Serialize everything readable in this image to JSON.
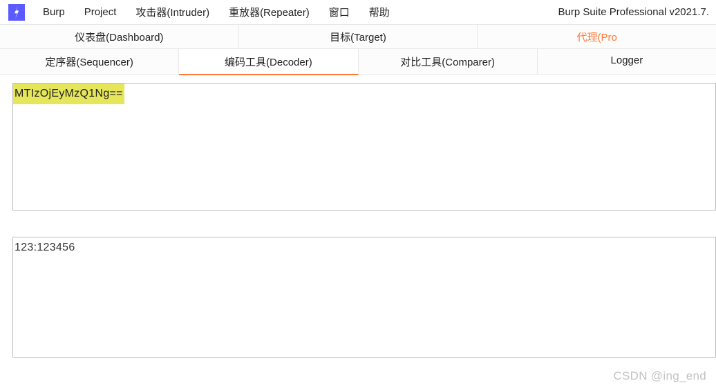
{
  "app": {
    "title": "Burp Suite Professional v2021.7."
  },
  "menu": {
    "items": [
      "Burp",
      "Project",
      "攻击器(Intruder)",
      "重放器(Repeater)",
      "窗口",
      "帮助"
    ]
  },
  "tabs_row1": {
    "items": [
      {
        "label": "仪表盘(Dashboard)"
      },
      {
        "label": "目标(Target)"
      },
      {
        "label": "代理(Pro"
      }
    ]
  },
  "tabs_row2": {
    "items": [
      {
        "label": "定序器(Sequencer)",
        "active": false
      },
      {
        "label": "编码工具(Decoder)",
        "active": true
      },
      {
        "label": "对比工具(Comparer)",
        "active": false
      },
      {
        "label": "Logger",
        "active": false
      }
    ]
  },
  "decoder": {
    "input_text": "MTIzOjEyMzQ1Ng==",
    "output_text": "123:123456"
  },
  "watermark": "CSDN @ing_end"
}
